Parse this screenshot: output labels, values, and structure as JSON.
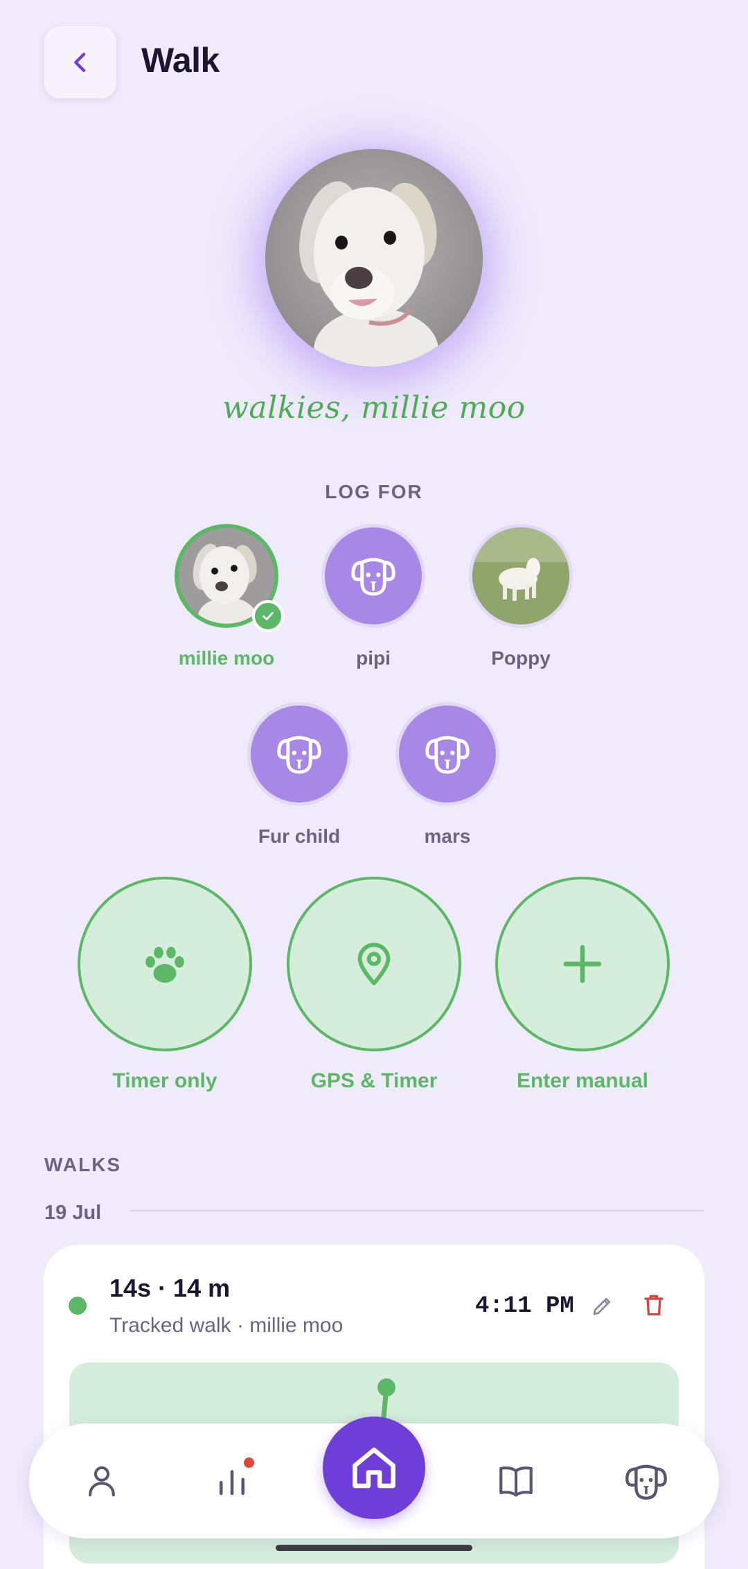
{
  "header": {
    "title": "Walk",
    "back_icon": "chevron-left-icon"
  },
  "hero": {
    "caption": "walkies, millie moo"
  },
  "log_for": {
    "label": "LOG FOR",
    "dogs": [
      {
        "name": "millie moo",
        "selected": true,
        "avatar": "photo"
      },
      {
        "name": "pipi",
        "selected": false,
        "avatar": "dog-face-icon"
      },
      {
        "name": "Poppy",
        "selected": false,
        "avatar": "photo"
      },
      {
        "name": "Fur child",
        "selected": false,
        "avatar": "dog-face-icon"
      },
      {
        "name": "mars",
        "selected": false,
        "avatar": "dog-face-icon"
      }
    ]
  },
  "actions": [
    {
      "label": "Timer only",
      "icon": "paw-icon"
    },
    {
      "label": "GPS & Timer",
      "icon": "location-pin-icon"
    },
    {
      "label": "Enter manual",
      "icon": "plus-icon"
    }
  ],
  "walks": {
    "section_label": "WALKS",
    "groups": [
      {
        "date": "19 Jul",
        "items": [
          {
            "title": "14s · 14 m",
            "subtitle": "Tracked walk · millie moo",
            "time": "4:11 PM"
          }
        ]
      }
    ]
  },
  "bottom_nav": {
    "items": [
      {
        "name": "profile",
        "icon": "person-icon"
      },
      {
        "name": "stats",
        "icon": "bar-chart-icon",
        "has_notification": true
      },
      {
        "name": "home",
        "icon": "home-icon",
        "active": true
      },
      {
        "name": "guide",
        "icon": "book-icon"
      },
      {
        "name": "dogs",
        "icon": "dog-face-icon"
      }
    ]
  },
  "colors": {
    "background": "#efebfb",
    "accent_purple": "#6f3ed8",
    "accent_green": "#5cb767",
    "avatar_purple": "#a788e6",
    "danger_red": "#d9423a"
  }
}
